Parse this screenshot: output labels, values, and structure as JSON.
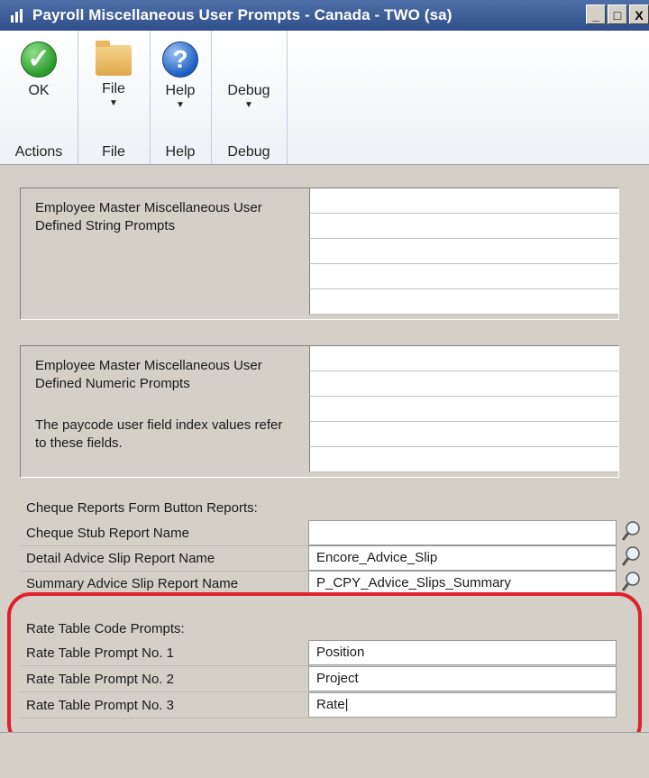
{
  "window": {
    "title": "Payroll Miscellaneous User Prompts - Canada  -  TWO (sa)",
    "controls": [
      "_",
      "□",
      "X"
    ]
  },
  "ribbon": {
    "groups": [
      {
        "button": "OK",
        "icon": "ok-checkmark-icon",
        "label": "Actions"
      },
      {
        "button": "File",
        "icon": "folder-icon",
        "label": "File"
      },
      {
        "button": "Help",
        "icon": "help-icon",
        "label": "Help"
      },
      {
        "button": "Debug",
        "icon": "",
        "label": "Debug"
      }
    ]
  },
  "string_prompts": {
    "label": "Employee Master Miscellaneous User Defined String Prompts",
    "values": [
      "",
      "",
      "",
      "",
      ""
    ]
  },
  "numeric_prompts": {
    "label": "Employee Master Miscellaneous User Defined Numeric Prompts",
    "note": "The paycode user field index values refer to these fields.",
    "values": [
      "",
      "",
      "",
      "",
      ""
    ]
  },
  "cheque_reports": {
    "heading": "Cheque Reports Form Button Reports:",
    "rows": [
      {
        "label": "Cheque Stub Report Name",
        "value": ""
      },
      {
        "label": "Detail Advice Slip Report Name",
        "value": "Encore_Advice_Slip"
      },
      {
        "label": "Summary Advice Slip Report Name",
        "value": "P_CPY_Advice_Slips_Summary"
      }
    ]
  },
  "rate_table": {
    "heading": "Rate Table Code Prompts:",
    "rows": [
      {
        "label": "Rate Table Prompt No. 1",
        "value": "Position"
      },
      {
        "label": "Rate Table Prompt No. 2",
        "value": "Project"
      },
      {
        "label": "Rate Table Prompt No. 3",
        "value": "Rate|"
      }
    ]
  },
  "colors": {
    "title_bar": "#2f4f8a",
    "highlight": "#e0212b",
    "window_bg": "#d4d0c8"
  }
}
